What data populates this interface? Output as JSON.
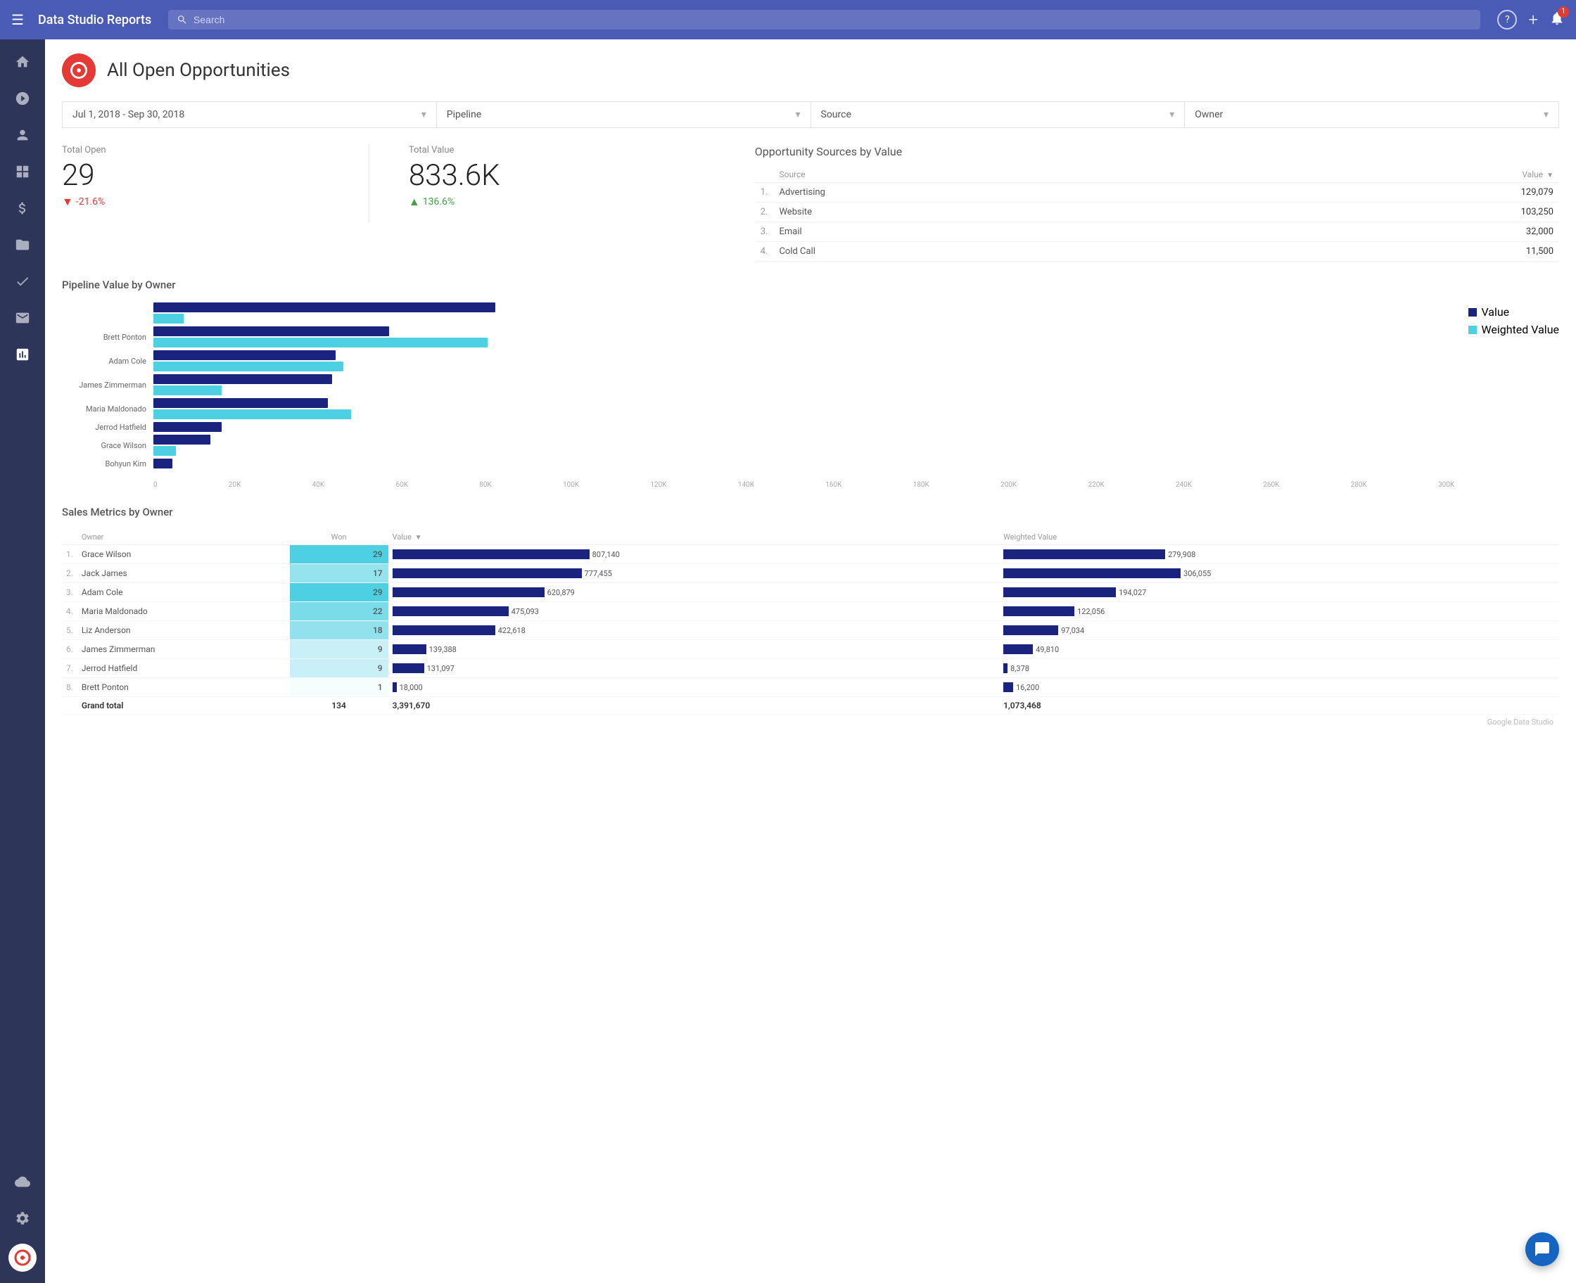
{
  "app": {
    "title": "Data Studio Reports",
    "search_placeholder": "Search"
  },
  "nav_icons": {
    "menu": "☰",
    "help": "?",
    "add": "+",
    "notification_count": "1"
  },
  "sidebar": {
    "items": [
      {
        "icon": "⌂",
        "label": "home",
        "active": false
      },
      {
        "icon": "◎",
        "label": "target",
        "active": false
      },
      {
        "icon": "👤",
        "label": "contact",
        "active": false
      },
      {
        "icon": "▦",
        "label": "grid",
        "active": false
      },
      {
        "icon": "$",
        "label": "dollar",
        "active": false
      },
      {
        "icon": "🗂",
        "label": "folder",
        "active": false
      },
      {
        "icon": "✔",
        "label": "check",
        "active": false
      },
      {
        "icon": "✉",
        "label": "mail",
        "active": false
      },
      {
        "icon": "▤",
        "label": "reports",
        "active": true
      },
      {
        "icon": "☁",
        "label": "cloud",
        "active": false
      },
      {
        "icon": "⚙",
        "label": "settings",
        "active": false
      }
    ],
    "logo_icon": "◔"
  },
  "page": {
    "title": "All Open Opportunities",
    "icon": "◔"
  },
  "filters": [
    {
      "label": "Jul 1, 2018 - Sep 30, 2018"
    },
    {
      "label": "Pipeline"
    },
    {
      "label": "Source"
    },
    {
      "label": "Owner"
    }
  ],
  "stats": {
    "total_open": {
      "label": "Total Open",
      "value": "29",
      "change": "-21.6%",
      "direction": "down"
    },
    "total_value": {
      "label": "Total Value",
      "value": "833.6K",
      "change": "136.6%",
      "direction": "up"
    }
  },
  "opp_sources": {
    "title": "Opportunity Sources by Value",
    "col_source": "Source",
    "col_value": "Value",
    "rows": [
      {
        "rank": "1.",
        "source": "Advertising",
        "value": "129,079",
        "bar_pct": 100
      },
      {
        "rank": "2.",
        "source": "Website",
        "value": "103,250",
        "bar_pct": 80
      },
      {
        "rank": "3.",
        "source": "Email",
        "value": "32,000",
        "bar_pct": 25
      },
      {
        "rank": "4.",
        "source": "Cold Call",
        "value": "11,500",
        "bar_pct": 9
      }
    ]
  },
  "pipeline_chart": {
    "title": "Pipeline Value by Owner",
    "legend": [
      {
        "label": "Value",
        "color": "#1a237e"
      },
      {
        "label": "Weighted Value",
        "color": "#4dd0e1"
      }
    ],
    "x_axis": [
      "0",
      "20K",
      "40K",
      "60K",
      "80K",
      "100K",
      "120K",
      "140K",
      "160K",
      "180K",
      "200K",
      "220K",
      "240K",
      "260K",
      "280K",
      "300K"
    ],
    "rows": [
      {
        "label": "",
        "dark_pct": 90,
        "teal_pct": 8
      },
      {
        "label": "Brett Ponton",
        "dark_pct": 62,
        "teal_pct": 88
      },
      {
        "label": "Adam Cole",
        "dark_pct": 48,
        "teal_pct": 50
      },
      {
        "label": "James Zimmerman",
        "dark_pct": 47,
        "teal_pct": 18
      },
      {
        "label": "Maria Maldonado",
        "dark_pct": 46,
        "teal_pct": 52
      },
      {
        "label": "Jerrod Hatfield",
        "dark_pct": 18,
        "teal_pct": 0
      },
      {
        "label": "Grace Wilson",
        "dark_pct": 15,
        "teal_pct": 6
      },
      {
        "label": "Bohyun Kim",
        "dark_pct": 5,
        "teal_pct": 0
      }
    ]
  },
  "sales_metrics": {
    "title": "Sales Metrics by Owner",
    "col_owner": "Owner",
    "col_won": "Won",
    "col_value": "Value",
    "col_weighted": "Weighted Value",
    "rows": [
      {
        "rank": "1.",
        "owner": "Grace Wilson",
        "won": 29,
        "won_shade": 1.0,
        "value": "807,140",
        "value_bar": 100,
        "weighted": "279,908",
        "weighted_bar": 82
      },
      {
        "rank": "2.",
        "owner": "Jack James",
        "won": 17,
        "won_shade": 0.6,
        "value": "777,455",
        "value_bar": 96,
        "weighted": "306,055",
        "weighted_bar": 90
      },
      {
        "rank": "3.",
        "owner": "Adam Cole",
        "won": 29,
        "won_shade": 1.0,
        "value": "620,879",
        "value_bar": 77,
        "weighted": "194,027",
        "weighted_bar": 57
      },
      {
        "rank": "4.",
        "owner": "Maria Maldonado",
        "won": 22,
        "won_shade": 0.75,
        "value": "475,093",
        "value_bar": 59,
        "weighted": "122,056",
        "weighted_bar": 36
      },
      {
        "rank": "5.",
        "owner": "Liz Anderson",
        "won": 18,
        "won_shade": 0.62,
        "value": "422,618",
        "value_bar": 52,
        "weighted": "97,034",
        "weighted_bar": 28
      },
      {
        "rank": "6.",
        "owner": "James Zimmerman",
        "won": 9,
        "won_shade": 0.31,
        "value": "139,388",
        "value_bar": 17,
        "weighted": "49,810",
        "weighted_bar": 15
      },
      {
        "rank": "7.",
        "owner": "Jerrod Hatfield",
        "won": 9,
        "won_shade": 0.31,
        "value": "131,097",
        "value_bar": 16,
        "weighted": "8,378",
        "weighted_bar": 2
      },
      {
        "rank": "8.",
        "owner": "Brett Ponton",
        "won": 1,
        "won_shade": 0.05,
        "value": "18,000",
        "value_bar": 2,
        "weighted": "16,200",
        "weighted_bar": 5
      }
    ],
    "grand_total": {
      "label": "Grand total",
      "won": "134",
      "value": "3,391,670",
      "weighted": "1,073,468"
    }
  },
  "watermark": "Google Data Studio",
  "chat_icon": "💬"
}
